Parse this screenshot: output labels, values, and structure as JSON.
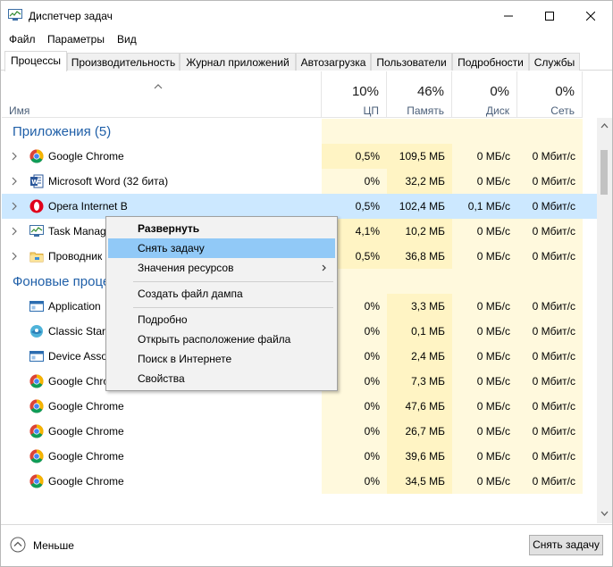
{
  "window": {
    "title": "Диспетчер задач"
  },
  "menu": [
    "Файл",
    "Параметры",
    "Вид"
  ],
  "tabs": [
    "Процессы",
    "Производительность",
    "Журнал приложений",
    "Автозагрузка",
    "Пользователи",
    "Подробности",
    "Службы"
  ],
  "columns": {
    "name": "Имя",
    "cpu": {
      "pct": "10%",
      "label": "ЦП"
    },
    "mem": {
      "pct": "46%",
      "label": "Память"
    },
    "disk": {
      "pct": "0%",
      "label": "Диск"
    },
    "net": {
      "pct": "0%",
      "label": "Сеть"
    }
  },
  "groups": {
    "apps": "Приложения (5)",
    "background": "Фоновые процессы"
  },
  "apps": [
    {
      "name": "Google Chrome",
      "icon": "chrome-icon",
      "cpu": "0,5%",
      "mem": "109,5 МБ",
      "disk": "0 МБ/с",
      "net": "0 Мбит/с"
    },
    {
      "name": "Microsoft Word (32 бита)",
      "icon": "word-icon",
      "cpu": "0%",
      "mem": "32,2 МБ",
      "disk": "0 МБ/с",
      "net": "0 Мбит/с"
    },
    {
      "name": "Opera Internet B",
      "icon": "opera-icon",
      "cpu": "0,5%",
      "mem": "102,4 МБ",
      "disk": "0,1 МБ/с",
      "net": "0 Мбит/с"
    },
    {
      "name": "Task Manager",
      "icon": "task-manager-icon",
      "cpu": "4,1%",
      "mem": "10,2 МБ",
      "disk": "0 МБ/с",
      "net": "0 Мбит/с"
    },
    {
      "name": "Проводник",
      "icon": "explorer-icon",
      "cpu": "0,5%",
      "mem": "36,8 МБ",
      "disk": "0 МБ/с",
      "net": "0 Мбит/с"
    }
  ],
  "background": [
    {
      "name": "Application",
      "icon": "app-window-icon",
      "cpu": "0%",
      "mem": "3,3 МБ",
      "disk": "0 МБ/с",
      "net": "0 Мбит/с"
    },
    {
      "name": "Classic Start",
      "icon": "classic-start-icon",
      "cpu": "0%",
      "mem": "0,1 МБ",
      "disk": "0 МБ/с",
      "net": "0 Мбит/с"
    },
    {
      "name": "Device Asso",
      "icon": "app-window-icon",
      "cpu": "0%",
      "mem": "2,4 МБ",
      "disk": "0 МБ/с",
      "net": "0 Мбит/с"
    },
    {
      "name": "Google Chrome",
      "icon": "chrome-icon",
      "cpu": "0%",
      "mem": "7,3 МБ",
      "disk": "0 МБ/с",
      "net": "0 Мбит/с"
    },
    {
      "name": "Google Chrome",
      "icon": "chrome-icon",
      "cpu": "0%",
      "mem": "47,6 МБ",
      "disk": "0 МБ/с",
      "net": "0 Мбит/с"
    },
    {
      "name": "Google Chrome",
      "icon": "chrome-icon",
      "cpu": "0%",
      "mem": "26,7 МБ",
      "disk": "0 МБ/с",
      "net": "0 Мбит/с"
    },
    {
      "name": "Google Chrome",
      "icon": "chrome-icon",
      "cpu": "0%",
      "mem": "39,6 МБ",
      "disk": "0 МБ/с",
      "net": "0 Мбит/с"
    },
    {
      "name": "Google Chrome",
      "icon": "chrome-icon",
      "cpu": "0%",
      "mem": "34,5 МБ",
      "disk": "0 МБ/с",
      "net": "0 Мбит/с"
    }
  ],
  "context_menu": {
    "expand": "Развернуть",
    "end_task": "Снять задачу",
    "resource_values": "Значения ресурсов",
    "create_dump": "Создать файл дампа",
    "details": "Подробно",
    "open_location": "Открыть расположение файла",
    "search_online": "Поиск в Интернете",
    "properties": "Свойства"
  },
  "footer": {
    "less": "Меньше",
    "end_task": "Снять задачу"
  },
  "colors": {
    "accent": "#1f5fa8",
    "selected_row": "#cce8ff",
    "heat_high": "#fff4c4",
    "heat_low": "#fff9dd",
    "menu_highlight": "#91c9f7"
  }
}
